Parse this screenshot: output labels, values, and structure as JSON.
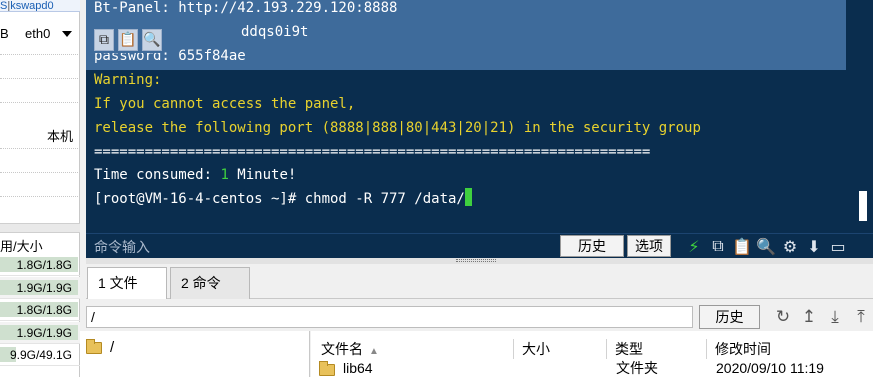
{
  "left_panel": {
    "swap_cut": "S",
    "swap_label": "kswapd0",
    "net_unit_cut": "B",
    "net_iface": "eth0",
    "local_label": "本机",
    "disk_header": "用/大小",
    "disks": [
      {
        "label": "1.8G/1.8G",
        "fill_fraction": 1.0
      },
      {
        "label": "1.9G/1.9G",
        "fill_fraction": 1.0
      },
      {
        "label": "1.8G/1.8G",
        "fill_fraction": 1.0
      },
      {
        "label": "1.9G/1.9G",
        "fill_fraction": 1.0
      },
      {
        "label": "9.9G/49.1G",
        "fill_fraction": 0.2
      }
    ]
  },
  "terminal": {
    "line1": "Bt-Panel: http://42.193.229.120:8888",
    "line2": "ddqs0i9t",
    "line3": "password: 655f84ae",
    "line4": "Warning:",
    "line5": "If you cannot access the panel,",
    "line6": "release the following port (8888|888|80|443|20|21) in the security group",
    "line7": "==================================================================",
    "time_prefix": "Time consumed: ",
    "time_value": "1",
    "time_suffix": " Minute!",
    "prompt": "[root@VM-16-4-centos ~]# chmod -R 777 /data/",
    "mini_tools": [
      "copy-icon",
      "paste-icon",
      "search-icon"
    ],
    "mini_glyphs": [
      "⧉",
      "📋",
      "🔍"
    ]
  },
  "cmdbar": {
    "input_placeholder": "命令输入",
    "history_label": "历史",
    "options_label": "选项",
    "tool_glyphs": [
      "⚡",
      "⧉",
      "📋",
      "🔍",
      "⚙",
      "⬇",
      "▭"
    ]
  },
  "tabs": [
    {
      "label": "1 文件",
      "active": true
    },
    {
      "label": "2 命令",
      "active": false
    }
  ],
  "file_browser": {
    "path": "/",
    "history_label": "历史",
    "tool_glyphs": [
      "↻",
      "↥",
      "⤓",
      "⤒"
    ],
    "tree_root": "/",
    "columns": [
      "文件名",
      "大小",
      "类型",
      "修改时间"
    ],
    "sort_glyph": "▲",
    "rows": [
      {
        "name": "lib64",
        "size": "",
        "type": "文件夹",
        "modified": "2020/09/10 11:19"
      }
    ]
  }
}
